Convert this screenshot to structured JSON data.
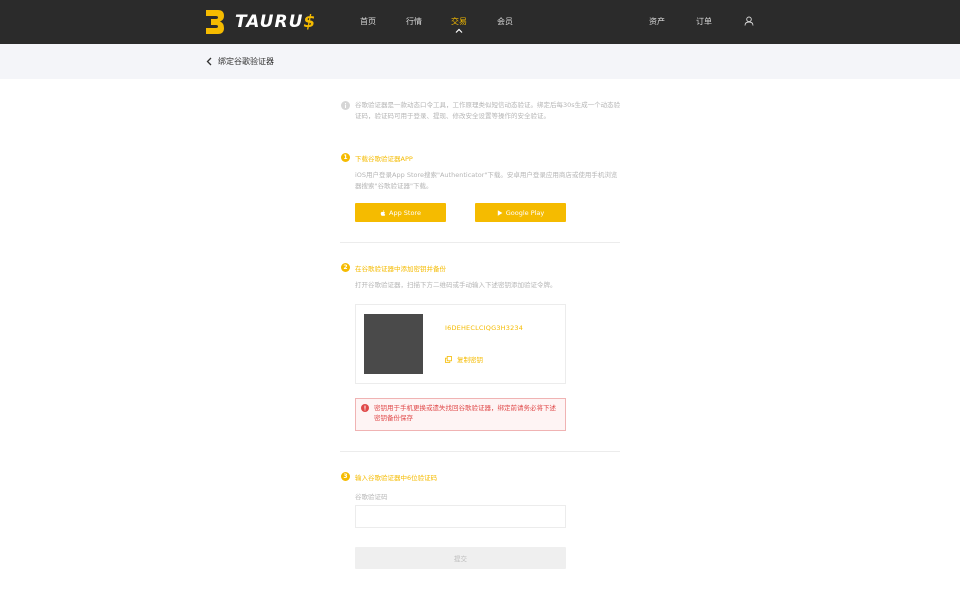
{
  "header": {
    "logo_text": "TAURU",
    "logo_suffix": "$",
    "nav": {
      "home": "首页",
      "market": "行情",
      "trade": "交易",
      "member": "会员",
      "assets": "资产",
      "orders": "订单"
    },
    "active_nav": "trade"
  },
  "page": {
    "back_label": "绑定谷歌验证器"
  },
  "intro": {
    "text": "谷歌验证器是一款动态口令工具，工作原理类似短信动态验证。绑定后每30s生成一个动态验证码，验证码可用于登录、提现、修改安全设置等操作的安全验证。"
  },
  "step1": {
    "number": "1",
    "title": "下载谷歌验证器APP",
    "desc": "iOS用户登录App Store搜索\"Authenticator\"下载。安卓用户登录应用商店或使用手机浏览器搜索\"谷歌验证器\"下载。",
    "app_store_label": "App Store",
    "google_play_label": "Google Play"
  },
  "step2": {
    "number": "2",
    "title": "在谷歌验证器中添加密钥并备份",
    "desc": "打开谷歌验证器，扫描下方二维码或手动输入下述密钥添加验证令牌。",
    "secret_key": "I6DEHECLCIQG3H3234",
    "copy_label": "复制密钥",
    "warning": "密钥用于手机更换或遗失找回谷歌验证器，绑定前请务必将下述密钥备份保存"
  },
  "step3": {
    "number": "3",
    "title": "输入谷歌验证器中6位验证码",
    "field_label": "谷歌验证码",
    "field_value": "",
    "submit_label": "提交"
  },
  "colors": {
    "accent": "#f5bb00",
    "topbar": "#2b2b2b",
    "subbar": "#f4f5f9",
    "warning": "#e04a4a",
    "muted_text": "#b5b5b5"
  },
  "icons": {
    "back": "chevron-left-icon",
    "info": "info-icon",
    "apple": "apple-icon",
    "play": "play-icon",
    "copy": "copy-icon",
    "alert": "alert-icon",
    "user": "user-icon"
  }
}
